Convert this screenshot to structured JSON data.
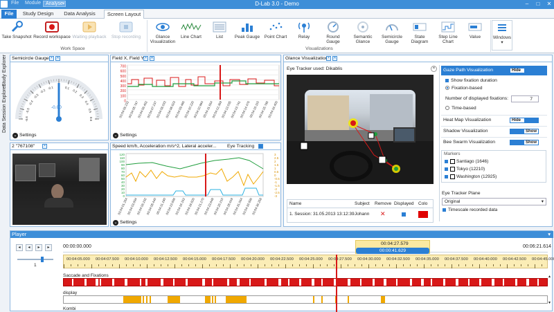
{
  "app": {
    "title": "D-Lab 3.0 - Demo",
    "menus": [
      "File",
      "Module",
      "Analyse"
    ]
  },
  "window_controls": [
    "minimize-icon",
    "maximize-icon",
    "close-icon"
  ],
  "tabs": [
    {
      "label": "File",
      "active": false
    },
    {
      "label": "Study Design",
      "active": false
    },
    {
      "label": "Data Analysis",
      "active": false
    },
    {
      "label": "Screen Layout",
      "active": true
    }
  ],
  "ribbon": {
    "workspace_group": "Work Space",
    "visualizations_group": "Visualizations",
    "windows_label": "Windows",
    "workspace_buttons": [
      {
        "label": "Take Snapshot",
        "icon": "wrench-icon",
        "enabled": true
      },
      {
        "label": "Record workspace",
        "icon": "record-icon",
        "enabled": true
      },
      {
        "label": "Waiting playback",
        "icon": "playback-icon",
        "enabled": false
      },
      {
        "label": "Stop recording",
        "icon": "stop-recording-icon",
        "enabled": false
      }
    ],
    "viz_buttons": [
      {
        "label": "Glance\nVisualization",
        "icon": "eye-icon"
      },
      {
        "label": "Line Chart",
        "icon": "line-chart-icon"
      },
      {
        "label": "List",
        "icon": "list-icon"
      },
      {
        "label": "Peak Gauge",
        "icon": "peak-gauge-icon"
      },
      {
        "label": "Point Chart",
        "icon": "point-chart-icon"
      },
      {
        "label": "Relay",
        "icon": "relay-icon"
      },
      {
        "label": "Round\nGauge",
        "icon": "round-gauge-icon"
      },
      {
        "label": "Semantic\nGlance",
        "icon": "semantic-glance-icon"
      },
      {
        "label": "Semicircle\nGauge",
        "icon": "semicircle-gauge-icon"
      },
      {
        "label": "State\nDiagram",
        "icon": "state-diagram-icon"
      },
      {
        "label": "Step Line\nChart",
        "icon": "step-line-chart-icon"
      },
      {
        "label": "Value",
        "icon": "value-icon"
      }
    ]
  },
  "side_tabs": [
    "Study Explorer",
    "Data Session Explorer"
  ],
  "semicircle_gauge": {
    "title": "Semicircle Gauge",
    "value": "-0.00",
    "tick_labels": [
      "-0.6",
      "-0.5",
      "-0.4",
      "-0.3",
      "-0.2",
      "-0.1",
      "0",
      "0.1",
      "0.2",
      "0.3",
      "0.4",
      "0.5",
      "0.6"
    ],
    "settings": "Settings"
  },
  "field_chart": {
    "title": "Field X, Field Y",
    "settings": "Settings",
    "y_ticks": [
      "700",
      "600",
      "500",
      "400",
      "300",
      "200",
      "100",
      "0"
    ],
    "x_ticks": [
      "00:04:05.232",
      "00:04:05.767",
      "00:04:06.492",
      "00:04:07.237",
      "00:04:08.033",
      "00:04:08.823",
      "00:04:09.486",
      "00:04:10.220",
      "00:04:10.984",
      "00:04:11.664",
      "00:04:12.359",
      "00:04:13.035",
      "00:04:13.741",
      "00:04:14.476",
      "00:04:15.115",
      "00:04:15.785",
      "00:04:16.400"
    ]
  },
  "camera": {
    "title": "2 \"767108\""
  },
  "speed_chart": {
    "title": "Speed km/h, Acceleration m/s^2, Lateral acceler...",
    "extra_tab": "Eye Tracking",
    "settings": "Settings",
    "y_ticks_left": [
      "120",
      "110",
      "100",
      "90",
      "80",
      "70",
      "60",
      "50",
      "40",
      "30",
      "20",
      "10",
      "0"
    ],
    "y_ticks_right": [
      "3",
      "2.5",
      "2",
      "1.5",
      "1",
      "0.5",
      "0",
      "-0.5",
      "-1",
      "-1.5",
      "-2",
      "-2.5",
      "-3"
    ],
    "x_ticks": [
      "00:04:01.264",
      "00:04:03.694",
      "00:04:06.192",
      "00:04:08.440",
      "00:04:11.180",
      "00:04:13.696",
      "00:04:16.162",
      "00:04:18.826",
      "00:04:21.270",
      "00:04:23.848",
      "00:04:26.210",
      "00:04:28.618",
      "00:04:31.064",
      "00:04:33.696",
      "00:04:36.258"
    ]
  },
  "glance": {
    "title": "Glance Visualization",
    "tracker": "Eye Tracker used: Dikablis",
    "table_headers": [
      "Name",
      "Subject",
      "Remove",
      "Displayed",
      "Colo"
    ],
    "table_rows": [
      {
        "name": "1. Session: 31.05.2013 13:12:39",
        "subject": "Johann"
      }
    ],
    "settings": {
      "gaze_path": "Gaze Path Visualization",
      "hide": "Hide",
      "show": "Show",
      "show_fixation_duration": "Show fixation duration",
      "fixation_based": "Fixation-based",
      "num_fixations_label": "Number of displayed fixations:",
      "num_fixations": "7",
      "time_based": "Time-based",
      "heat_map": "Heat Map Visualization",
      "shadow": "Shadow Visualization",
      "bee_swarm": "Bee Swarm Visualization",
      "markers_label": "Markers",
      "markers": [
        "Santiago (1646)",
        "Tokyo (12210)",
        "Washington (12925)"
      ],
      "eye_tracker_plane": "Eye Tracker Plane",
      "plane_value": "Original",
      "timescale": "Timescale recorded data"
    }
  },
  "player": {
    "title": "Player",
    "start": "00:00:00.000",
    "end": "00:06:21.614",
    "current": "00:04:27.579",
    "window": "00:00:41.629",
    "speed": "1",
    "ticks": [
      "00:04:05.000",
      "00:04:07.500",
      "00:04:10.000",
      "00:04:12.500",
      "00:04:15.000",
      "00:04:17.500",
      "00:04:20.000",
      "00:04:22.500",
      "00:04:25.000",
      "00:04:27.500",
      "00:04:30.000",
      "00:04:32.500",
      "00:04:35.000",
      "00:04:37.500",
      "00:04:40.000",
      "00:04:42.500",
      "00:04:45.000"
    ],
    "tracks": [
      "Saccade and Fixations",
      "display",
      "Kombi"
    ]
  },
  "colors": {
    "accent": "#3d8ed8",
    "red": "#d81818",
    "green": "#1f9d3c",
    "orange": "#f0a800",
    "cyan": "#2ab0e0"
  }
}
